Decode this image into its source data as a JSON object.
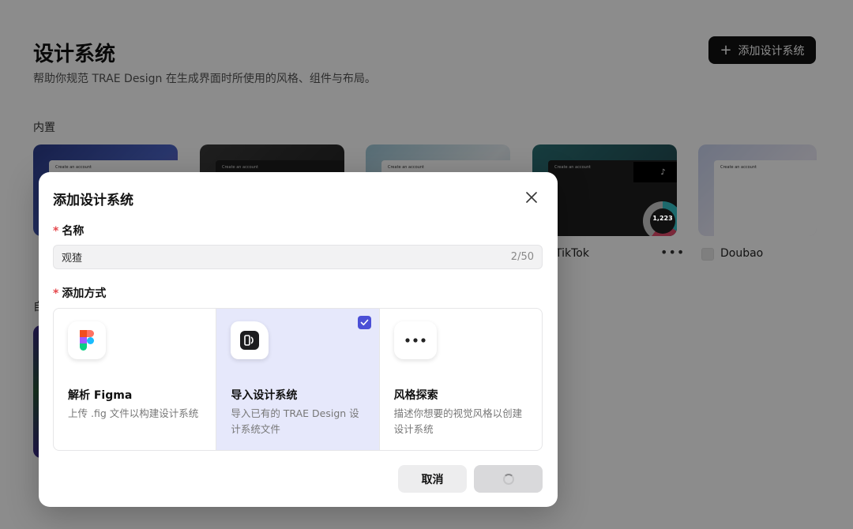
{
  "page": {
    "title": "设计系统",
    "subtitle": "帮助你规范 TRAE Design 在生成界面时所使用的风格、组件与布局。",
    "add_button_label": "添加设计系统",
    "builtin_label": "内置",
    "custom_label": "自",
    "cards": [
      {
        "preview_text": "Create an account",
        "caption": ""
      },
      {
        "preview_text": "Create an account",
        "caption": ""
      },
      {
        "preview_text": "Create an account",
        "caption": ""
      },
      {
        "preview_text": "Create an account",
        "caption": "TikTok",
        "donut_value": "1,223"
      },
      {
        "preview_text": "Create an account",
        "caption": "Doubao"
      }
    ]
  },
  "modal": {
    "title": "添加设计系统",
    "name_label": "名称",
    "required_mark": "*",
    "name_value": "观猹",
    "name_counter": "2/50",
    "method_label": "添加方式",
    "options": [
      {
        "title": "解析 Figma",
        "desc": "上传 .fig 文件以构建设计系统",
        "icon": "figma-icon",
        "selected": false
      },
      {
        "title": "导入设计系统",
        "desc": "导入已有的 TRAE Design 设计系统文件",
        "icon": "import-file-icon",
        "selected": true
      },
      {
        "title": "风格探索",
        "desc": "描述你想要的视觉风格以创建设计系统",
        "icon": "chat-bubble-icon",
        "selected": false
      }
    ],
    "cancel_label": "取消"
  },
  "colors": {
    "accent": "#4b4fd6",
    "selected_bg": "#e6e8fb",
    "required": "#e5484d"
  }
}
